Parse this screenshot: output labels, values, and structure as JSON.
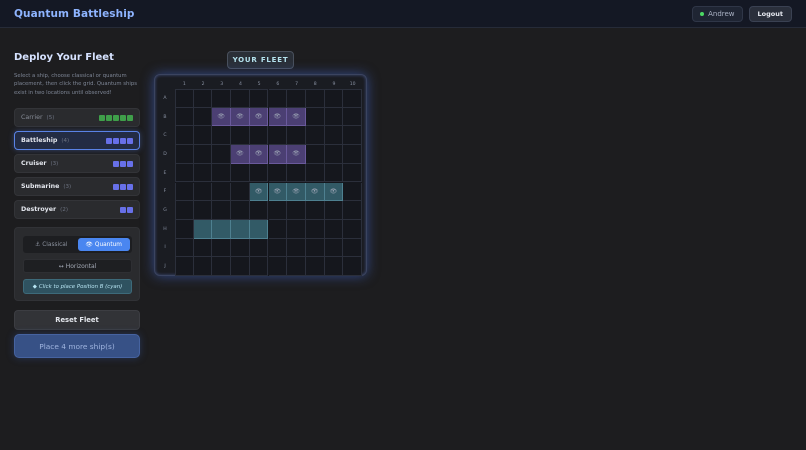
{
  "header": {
    "title": "Quantum Battleship",
    "user": "Andrew",
    "logout_label": "Logout"
  },
  "deploy": {
    "title": "Deploy Your Fleet",
    "description": "Select a ship, choose classical or quantum placement, then click the grid. Quantum ships exist in two locations until observed!"
  },
  "ships": [
    {
      "name": "Carrier",
      "size": "(5)",
      "state": "placed",
      "pips": 5
    },
    {
      "name": "Battleship",
      "size": "(4)",
      "state": "selected",
      "pips": 4
    },
    {
      "name": "Cruiser",
      "size": "(3)",
      "state": "available",
      "pips": 3
    },
    {
      "name": "Submarine",
      "size": "(3)",
      "state": "available",
      "pips": 3
    },
    {
      "name": "Destroyer",
      "size": "(2)",
      "state": "available",
      "pips": 2
    }
  ],
  "placement": {
    "classical_label": "Classical",
    "quantum_label": "Quantum",
    "active_mode": "quantum",
    "orientation_label": "Horizontal",
    "hint": "Click to place Position B (cyan)"
  },
  "actions": {
    "reset_label": "Reset Fleet",
    "place_label": "Place 4 more ship(s)"
  },
  "board": {
    "title": "YOUR FLEET",
    "columns": [
      "1",
      "2",
      "3",
      "4",
      "5",
      "6",
      "7",
      "8",
      "9",
      "10"
    ],
    "rows": [
      "A",
      "B",
      "C",
      "D",
      "E",
      "F",
      "G",
      "H",
      "I",
      "J"
    ],
    "placed_cells": [
      {
        "row": "B",
        "col": 3,
        "color": "purple",
        "quantum": true
      },
      {
        "row": "B",
        "col": 4,
        "color": "purple",
        "quantum": true
      },
      {
        "row": "B",
        "col": 5,
        "color": "purple",
        "quantum": true
      },
      {
        "row": "B",
        "col": 6,
        "color": "purple",
        "quantum": true
      },
      {
        "row": "B",
        "col": 7,
        "color": "purple",
        "quantum": true
      },
      {
        "row": "D",
        "col": 4,
        "color": "purple",
        "quantum": true
      },
      {
        "row": "D",
        "col": 5,
        "color": "purple",
        "quantum": true
      },
      {
        "row": "D",
        "col": 6,
        "color": "purple",
        "quantum": true
      },
      {
        "row": "D",
        "col": 7,
        "color": "purple",
        "quantum": true
      },
      {
        "row": "F",
        "col": 5,
        "color": "teal",
        "quantum": true
      },
      {
        "row": "F",
        "col": 6,
        "color": "teal",
        "quantum": true
      },
      {
        "row": "F",
        "col": 7,
        "color": "teal",
        "quantum": true
      },
      {
        "row": "F",
        "col": 8,
        "color": "teal",
        "quantum": true
      },
      {
        "row": "F",
        "col": 9,
        "color": "teal",
        "quantum": true
      },
      {
        "row": "H",
        "col": 2,
        "color": "teal",
        "quantum": false
      },
      {
        "row": "H",
        "col": 3,
        "color": "teal",
        "quantum": false
      },
      {
        "row": "H",
        "col": 4,
        "color": "teal",
        "quantum": false
      },
      {
        "row": "H",
        "col": 5,
        "color": "teal",
        "quantum": false
      }
    ]
  },
  "colors": {
    "accent": "#4a86f0",
    "quantum_a": "#4b3f73",
    "quantum_b": "#325a66",
    "placed_pip": "#3f9f4a",
    "pending_pip": "#6770e8"
  },
  "icons": {
    "classical": "anchor-icon",
    "quantum": "eye-icon",
    "orientation": "arrows-icon",
    "hint": "diamond-icon"
  }
}
